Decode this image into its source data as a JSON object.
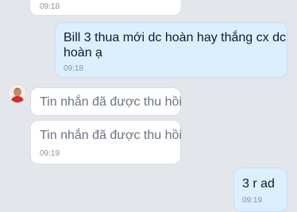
{
  "messages": [
    {
      "sender": "other",
      "text": "",
      "time": "09:18"
    },
    {
      "sender": "self",
      "text_line1": "Bill 3 thua mới dc hoàn hay thắng cx dc",
      "text_line2": "hoàn ạ",
      "time": "09:18"
    },
    {
      "sender": "other",
      "text": "Tin nhắn đã được thu hồi",
      "time": ""
    },
    {
      "sender": "other",
      "text": "Tin nhắn đã được thu hồi",
      "time": "09:19"
    },
    {
      "sender": "self",
      "text": "3 r ad",
      "time": "09:19"
    }
  ],
  "colors": {
    "background": "#e3e6eb",
    "incoming_bubble": "#ffffff",
    "outgoing_bubble": "#dcefff"
  }
}
